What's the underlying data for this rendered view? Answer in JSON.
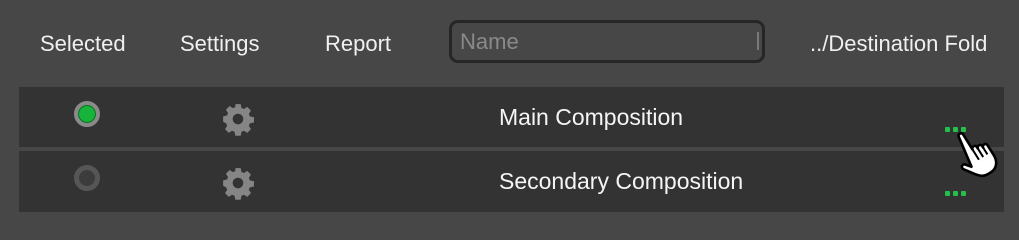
{
  "header": {
    "selected_label": "Selected",
    "settings_label": "Settings",
    "report_label": "Report",
    "search": {
      "placeholder": "Name",
      "value": ""
    },
    "destination_label": "../Destination Fold"
  },
  "rows": [
    {
      "selected": true,
      "name": "Main Composition",
      "gear_icon": "gear-icon",
      "more_icon": "more-dots-icon"
    },
    {
      "selected": false,
      "name": "Secondary Composition",
      "gear_icon": "gear-icon",
      "more_icon": "more-dots-icon"
    }
  ],
  "colors": {
    "background": "#474747",
    "row_background": "#333333",
    "accent_green": "#17b33a",
    "dots_green": "#25c04a"
  },
  "cursor_icon": "hand-pointer-icon"
}
